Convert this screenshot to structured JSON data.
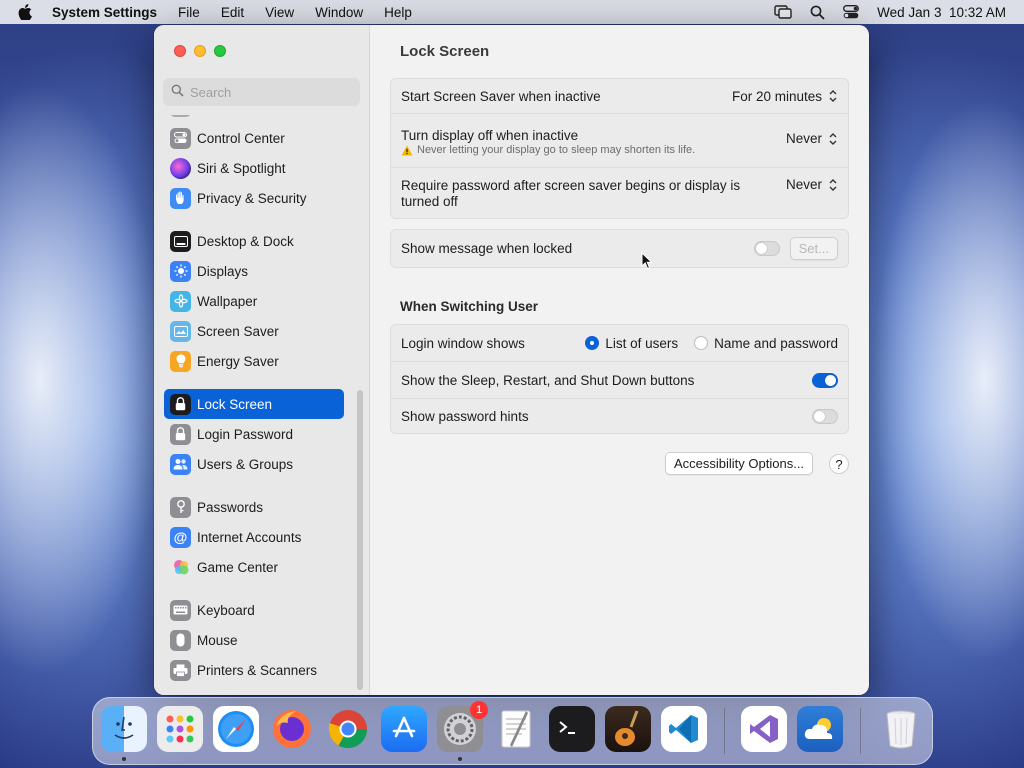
{
  "menubar": {
    "app_name": "System Settings",
    "menus": [
      "File",
      "Edit",
      "View",
      "Window",
      "Help"
    ],
    "clock": "Wed Jan 3  10:32 AM"
  },
  "search": {
    "placeholder": "Search"
  },
  "sidebar": {
    "items": [
      {
        "label": "Control Center",
        "icon": "control-center-icon",
        "color": "#8e8e93"
      },
      {
        "label": "Siri & Spotlight",
        "icon": "siri-icon",
        "color": "#b23ad9"
      },
      {
        "label": "Privacy & Security",
        "icon": "hand-icon",
        "color": "#3f8cf5"
      },
      {
        "label": "Desktop & Dock",
        "icon": "dock-icon",
        "color": "#1c1c1e"
      },
      {
        "label": "Displays",
        "icon": "sun-icon",
        "color": "#3a82f6"
      },
      {
        "label": "Wallpaper",
        "icon": "flower-icon",
        "color": "#45b5e6"
      },
      {
        "label": "Screen Saver",
        "icon": "screen-saver-icon",
        "color": "#64b7e8"
      },
      {
        "label": "Energy Saver",
        "icon": "bulb-icon",
        "color": "#f5a623"
      },
      {
        "label": "Lock Screen",
        "icon": "lock-icon",
        "color": "#1c1c1e"
      },
      {
        "label": "Login Password",
        "icon": "lock-icon",
        "color": "#8e8e93"
      },
      {
        "label": "Users & Groups",
        "icon": "users-icon",
        "color": "#3a82f6"
      },
      {
        "label": "Passwords",
        "icon": "key-icon",
        "color": "#8e8e93"
      },
      {
        "label": "Internet Accounts",
        "icon": "at-icon",
        "color": "#3a82f6"
      },
      {
        "label": "Game Center",
        "icon": "game-center-icon",
        "color": "#ffffff"
      },
      {
        "label": "Keyboard",
        "icon": "keyboard-icon",
        "color": "#8e8e93"
      },
      {
        "label": "Mouse",
        "icon": "mouse-icon",
        "color": "#8e8e93"
      },
      {
        "label": "Printers & Scanners",
        "icon": "printer-icon",
        "color": "#8e8e93"
      }
    ],
    "active": "Lock Screen"
  },
  "main": {
    "title": "Lock Screen",
    "screen_saver": {
      "label": "Start Screen Saver when inactive",
      "value": "For 20 minutes"
    },
    "display_off": {
      "label": "Turn display off when inactive",
      "value": "Never",
      "warning": "Never letting your display go to sleep may shorten its life."
    },
    "require_password": {
      "label": "Require password after screen saver begins or display is turned off",
      "value": "Never"
    },
    "message": {
      "label": "Show message when locked",
      "enabled": false,
      "set_button": "Set..."
    },
    "switching_title": "When Switching User",
    "login_window": {
      "label": "Login window shows",
      "options": [
        "List of users",
        "Name and password"
      ],
      "selected": "List of users"
    },
    "sleep_buttons": {
      "label": "Show the Sleep, Restart, and Shut Down buttons",
      "enabled": true
    },
    "password_hints": {
      "label": "Show password hints",
      "enabled": false
    },
    "accessibility_button": "Accessibility Options...",
    "help_button": "?"
  },
  "dock": {
    "apps": [
      {
        "name": "Finder",
        "icon": "finder-icon",
        "running": true
      },
      {
        "name": "Launchpad",
        "icon": "launchpad-icon",
        "running": false
      },
      {
        "name": "Safari",
        "icon": "safari-icon",
        "running": false
      },
      {
        "name": "Firefox",
        "icon": "firefox-icon",
        "running": false
      },
      {
        "name": "Chrome",
        "icon": "chrome-icon",
        "running": false
      },
      {
        "name": "App Store",
        "icon": "app-store-icon",
        "running": false
      },
      {
        "name": "System Settings",
        "icon": "settings-gear-icon",
        "running": true,
        "badge": "1"
      },
      {
        "name": "TextEdit",
        "icon": "textedit-icon",
        "running": false
      },
      {
        "name": "Terminal",
        "icon": "terminal-icon",
        "running": false
      },
      {
        "name": "GarageBand",
        "icon": "garageband-icon",
        "running": false
      },
      {
        "name": "VS Code",
        "icon": "vscode-icon",
        "running": false
      },
      {
        "name": "Visual Studio",
        "icon": "visual-studio-icon",
        "running": false
      },
      {
        "name": "Weather",
        "icon": "weather-icon",
        "running": false
      },
      {
        "name": "Trash",
        "icon": "trash-icon",
        "running": false
      }
    ]
  }
}
